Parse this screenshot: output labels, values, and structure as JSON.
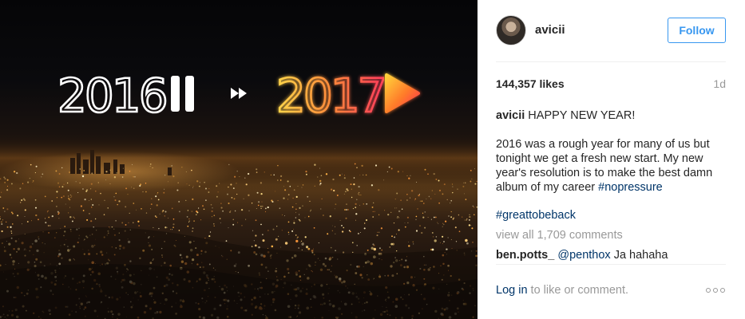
{
  "media": {
    "left_year": "2016",
    "right_year": "2017"
  },
  "post": {
    "username": "avicii",
    "follow_label": "Follow",
    "likes": "144,357 likes",
    "age": "1d",
    "caption_user": "avicii",
    "caption_title": " HAPPY NEW YEAR!",
    "caption_body": "2016 was a rough year for many of us but tonight we get a fresh new start. My new year's resolution is to make the best damn album of my career ",
    "caption_tag": "#nopressure",
    "hashtag_line": "#greattobeback",
    "view_all": "view all 1,709 comments",
    "comment": {
      "user": "ben.potts_",
      "mention": "@penthox",
      "text": " Ja hahaha"
    },
    "login_label": "Log in",
    "login_suffix": " to like or comment."
  },
  "icons": {
    "pause": "pause-icon",
    "fast_forward": "fast-forward-icon",
    "play": "play-icon",
    "more": "more-options-icon"
  }
}
